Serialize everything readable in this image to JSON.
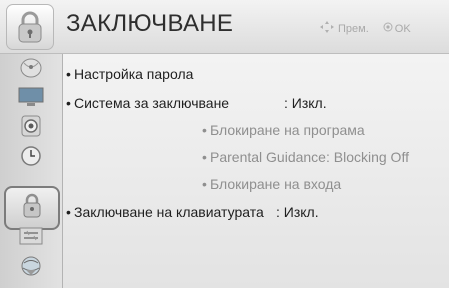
{
  "header": {
    "title": "ЗАКЛЮЧВАНЕ",
    "hint_move": "Прем.",
    "hint_ok": "OK"
  },
  "sidebar": {
    "items": [
      {
        "icon": "satellite-dish-icon"
      },
      {
        "icon": "tv-screen-icon"
      },
      {
        "icon": "speaker-icon"
      },
      {
        "icon": "clock-icon"
      },
      {
        "icon": "lock-icon",
        "selected": true
      },
      {
        "icon": "options-icon"
      },
      {
        "icon": "network-globe-icon"
      }
    ]
  },
  "menu": {
    "bullet": "•",
    "items": [
      {
        "label": "Настройка парола",
        "value": ""
      },
      {
        "label": "Система за заключване",
        "value": ": Изкл."
      },
      {
        "label": "Блокиране на програма",
        "value": ""
      },
      {
        "label": "Parental Guidance: Blocking Off",
        "value": ""
      },
      {
        "label": "Блокиране на входа",
        "value": ""
      },
      {
        "label": "Заключване на клавиатурата",
        "value": ": Изкл."
      }
    ]
  },
  "colors": {
    "text_primary": "#1f1f1f",
    "text_disabled": "#8f8f8f",
    "selection_border": "#7c7c7c"
  }
}
